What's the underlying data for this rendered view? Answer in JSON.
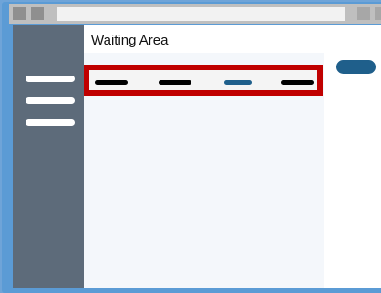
{
  "app": {
    "page_title": "Waiting Area"
  },
  "browser": {
    "address": ""
  },
  "nav": {
    "items": [
      {
        "label": ""
      },
      {
        "label": ""
      },
      {
        "label": "",
        "active": true
      },
      {
        "label": ""
      }
    ]
  },
  "sidebar": {
    "menu_icon": "hamburger-icon"
  },
  "colors": {
    "accent": "#1f5f8b",
    "highlight": "#c00000",
    "sidebar": "#5d6b7a"
  }
}
